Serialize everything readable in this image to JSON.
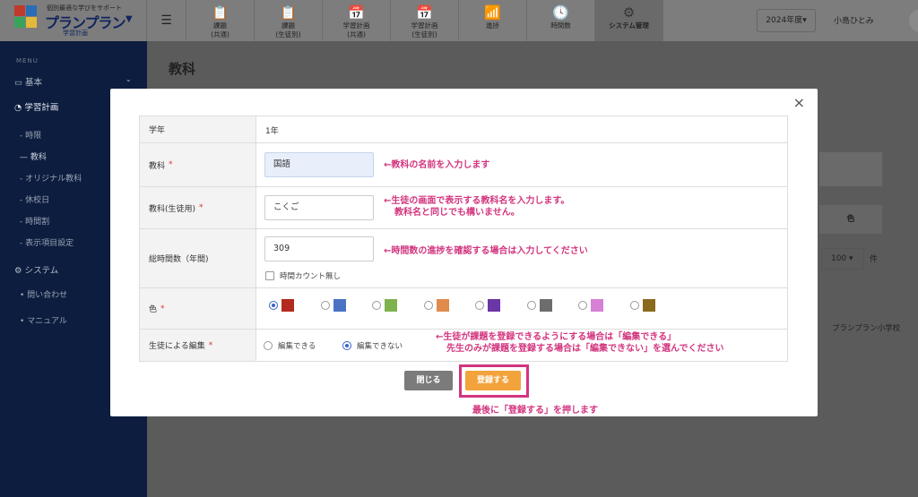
{
  "header": {
    "logo_tagline": "個別最適な学びをサポート",
    "logo_brand": "プランプラン",
    "logo_sub": "学習計画",
    "tabs": [
      {
        "line1": "課題",
        "line2": "(共通)"
      },
      {
        "line1": "課題",
        "line2": "(生徒別)"
      },
      {
        "line1": "学習計画",
        "line2": "(共通)"
      },
      {
        "line1": "学習計画",
        "line2": "(生徒別)"
      },
      {
        "line1": "",
        "line2": "進捗"
      },
      {
        "line1": "",
        "line2": "時間数"
      },
      {
        "line1": "",
        "line2": "システム管理"
      }
    ],
    "year": "2024年度",
    "user": "小島ひとみ",
    "more": "···"
  },
  "sidebar": {
    "menu_label": "MENU",
    "basic": "基本",
    "study_plan": "学習計画",
    "items": [
      "時限",
      "教科",
      "オリジナル教科",
      "休校日",
      "時間割",
      "表示項目設定"
    ],
    "system": "システム",
    "sys_items": [
      "問い合わせ",
      "マニュアル"
    ]
  },
  "page": {
    "title": "教科",
    "bg_color_header": "色",
    "bg_per_page": "100",
    "bg_per_page_unit": "件",
    "bg_school": "プランプラン小学校"
  },
  "modal": {
    "close_x": "×",
    "rows": {
      "grade_label": "学年",
      "grade_value": "1年",
      "subject_label": "教科",
      "subject_value": "国語",
      "subject_note": "←教科の名前を入力します",
      "student_label": "教科(生徒用)",
      "student_value": "こくご",
      "student_note1": "←生徒の画面で表示する教科名を入力します。",
      "student_note2": "教科名と同じでも構いません。",
      "hours_label": "総時間数（年間)",
      "hours_value": "309",
      "hours_note": "←時間数の進捗を確認する場合は入力してください",
      "hours_checkbox": "時間カウント無し",
      "color_label": "色",
      "edit_label": "生徒による編集",
      "edit_yes": "編集できる",
      "edit_no": "編集できない",
      "edit_note1": "←生徒が課題を登録できるようにする場合は「編集できる」",
      "edit_note2": "先生のみが課題を登録する場合は「編集できない」を選んでください"
    },
    "required_mark": "*",
    "colors": [
      "#b32a1f",
      "#4b73c4",
      "#7fb24f",
      "#e08a4b",
      "#6b36a6",
      "#6d6d6d",
      "#d680d6",
      "#8a6a1d"
    ],
    "selected_color_index": 0,
    "close_button": "閉じる",
    "save_button": "登録する",
    "save_note": "最後に「登録する」を押します"
  }
}
